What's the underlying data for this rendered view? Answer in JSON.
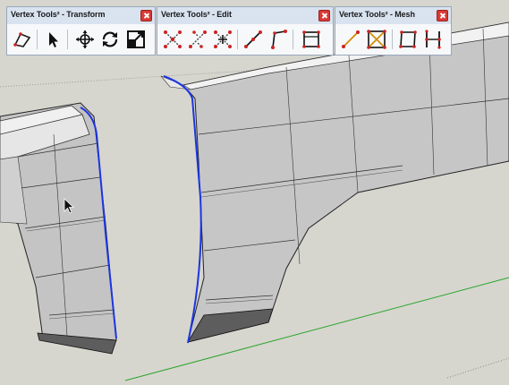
{
  "toolbars": {
    "transform": {
      "title": "Vertex Tools² - Transform"
    },
    "edit": {
      "title": "Vertex Tools² - Edit"
    },
    "mesh": {
      "title": "Vertex Tools² - Mesh"
    }
  },
  "icons": {
    "transform": [
      "soft-select-icon",
      "select-arrow-icon",
      "move-icon",
      "rotate-icon",
      "scale-icon"
    ],
    "edit": [
      "merge-vertices-icon",
      "merge-selected-icon",
      "weld-icon",
      "split-edge-icon",
      "bend-edge-icon",
      "quad-connect-icon"
    ],
    "mesh": [
      "connect-vertices-icon",
      "triangulate-quad-icon",
      "quad-face-icon",
      "insert-loop-icon"
    ]
  },
  "colors": {
    "viewport_bg": "#d8d8d1",
    "surface": "#c9c9c9",
    "surface_light": "#e3e3e3",
    "selected_edge": "#1d35e0",
    "green_axis": "#2ca42c",
    "icon_red": "#cc2222"
  }
}
